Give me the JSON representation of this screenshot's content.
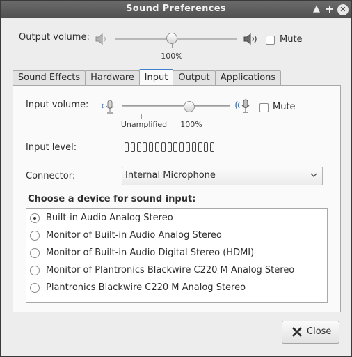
{
  "window": {
    "title": "Sound Preferences"
  },
  "output": {
    "label": "Output volume:",
    "value_label": "100%",
    "level_fraction": 0.46,
    "mute_label": "Mute",
    "muted": false
  },
  "tabs": [
    {
      "label": "Sound Effects",
      "active": false
    },
    {
      "label": "Hardware",
      "active": false
    },
    {
      "label": "Input",
      "active": true
    },
    {
      "label": "Output",
      "active": false
    },
    {
      "label": "Applications",
      "active": false
    }
  ],
  "input": {
    "volume_label": "Input volume:",
    "level_fraction": 0.62,
    "mark_unamplified": "Unamplified",
    "mark_100": "100%",
    "mute_label": "Mute",
    "muted": false,
    "level_label": "Input level:",
    "level_bars": 15,
    "connector_label": "Connector:",
    "connector_value": "Internal Microphone",
    "devices_heading": "Choose a device for sound input:",
    "devices": [
      {
        "label": "Built-in Audio Analog Stereo",
        "selected": true
      },
      {
        "label": "Monitor of Built-in Audio Analog Stereo",
        "selected": false
      },
      {
        "label": "Monitor of Built-in Audio Digital Stereo (HDMI)",
        "selected": false
      },
      {
        "label": "Monitor of Plantronics Blackwire C220 M Analog Stereo",
        "selected": false
      },
      {
        "label": "Plantronics Blackwire C220 M Analog Stereo",
        "selected": false
      }
    ]
  },
  "footer": {
    "close_label": "Close"
  },
  "icons": {
    "speaker_low": "speaker-low-icon",
    "speaker_high": "speaker-high-icon",
    "mic_low": "microphone-low-icon",
    "mic_high": "microphone-high-icon",
    "close": "close-x-icon"
  },
  "colors": {
    "accent": "#3d7fd1",
    "titlebar": "#5a5a5a"
  }
}
